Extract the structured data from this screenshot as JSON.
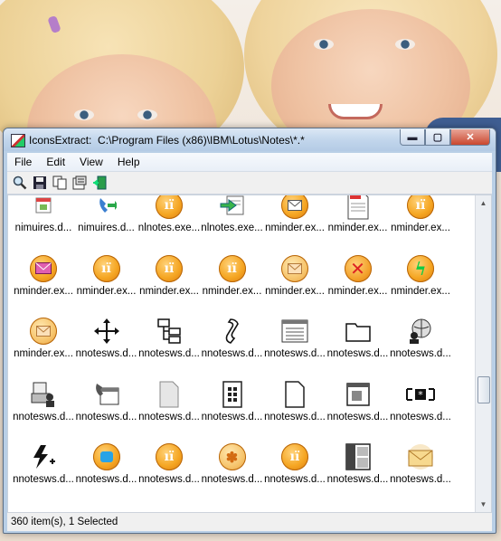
{
  "window": {
    "app_name": "IconsExtract:",
    "path": "C:\\Program Files (x86)\\IBM\\Lotus\\Notes\\*.*",
    "buttons": {
      "minimize": "▬",
      "maximize": "▢",
      "close": "✕"
    }
  },
  "menu": [
    "File",
    "Edit",
    "View",
    "Help"
  ],
  "toolbar": [
    "find-icon",
    "save-icon",
    "copy-icon",
    "properties-icon",
    "exit-icon"
  ],
  "icons": [
    {
      "label": "nimuires.d...",
      "icon": "window-icon"
    },
    {
      "label": "nimuires.d...",
      "icon": "phone-arrow-icon"
    },
    {
      "label": "nlnotes.exe...",
      "icon": "lotus-orb-icon"
    },
    {
      "label": "nlnotes.exe...",
      "icon": "green-arrow-icon"
    },
    {
      "label": "nminder.ex...",
      "icon": "orb-mail-icon"
    },
    {
      "label": "nminder.ex...",
      "icon": "doc-red-icon"
    },
    {
      "label": "nminder.ex...",
      "icon": "lotus-orb-icon"
    },
    {
      "label": "nminder.ex...",
      "icon": "orb-envelope-pink-icon"
    },
    {
      "label": "nminder.ex...",
      "icon": "lotus-orb-icon"
    },
    {
      "label": "nminder.ex...",
      "icon": "lotus-orb-icon"
    },
    {
      "label": "nminder.ex...",
      "icon": "lotus-orb-icon"
    },
    {
      "label": "nminder.ex...",
      "icon": "orb-envelope-icon"
    },
    {
      "label": "nminder.ex...",
      "icon": "orb-x-icon"
    },
    {
      "label": "nminder.ex...",
      "icon": "orb-lightning-icon"
    },
    {
      "label": "nminder.ex...",
      "icon": "orb-envelope-icon"
    },
    {
      "label": "nnotesws.d...",
      "icon": "move-cross-icon"
    },
    {
      "label": "nnotesws.d...",
      "icon": "tree-icon"
    },
    {
      "label": "nnotesws.d...",
      "icon": "scroll-icon"
    },
    {
      "label": "nnotesws.d...",
      "icon": "calendar-window-icon"
    },
    {
      "label": "nnotesws.d...",
      "icon": "folder-icon"
    },
    {
      "label": "nnotesws.d...",
      "icon": "globe-person-icon"
    },
    {
      "label": "nnotesws.d...",
      "icon": "printer-people-icon"
    },
    {
      "label": "nnotesws.d...",
      "icon": "phone-window-icon"
    },
    {
      "label": "nnotesws.d...",
      "icon": "page-gray-icon"
    },
    {
      "label": "nnotesws.d...",
      "icon": "page-grid-icon"
    },
    {
      "label": "nnotesws.d...",
      "icon": "page-icon"
    },
    {
      "label": "nnotesws.d...",
      "icon": "window-small-icon"
    },
    {
      "label": "nnotesws.d...",
      "icon": "star-field-icon"
    },
    {
      "label": "nnotesws.d...",
      "icon": "lightning-plus-icon"
    },
    {
      "label": "nnotesws.d...",
      "icon": "orb-blue-icon"
    },
    {
      "label": "nnotesws.d...",
      "icon": "lotus-orb-icon"
    },
    {
      "label": "nnotesws.d...",
      "icon": "orb-turtle-icon"
    },
    {
      "label": "nnotesws.d...",
      "icon": "lotus-orb-icon"
    },
    {
      "label": "nnotesws.d...",
      "icon": "layout-icon"
    },
    {
      "label": "nnotesws.d...",
      "icon": "envelope-icon"
    }
  ],
  "status": "360 item(s), 1 Selected"
}
